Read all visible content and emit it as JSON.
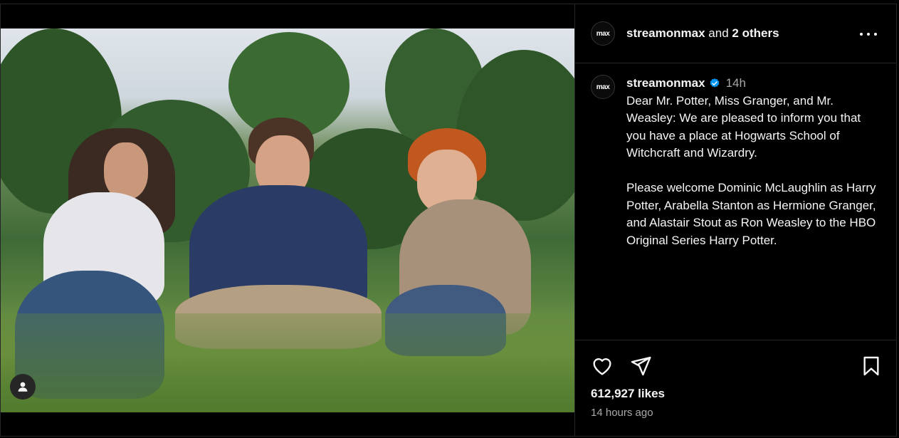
{
  "post": {
    "header_user": "streamonmax",
    "header_and": "and",
    "header_others": "2 others",
    "avatar_text": "max",
    "caption_user": "streamonmax",
    "caption_time": "14h",
    "caption_text": "Dear Mr. Potter, Miss Granger, and Mr. Weasley: We are pleased to inform you that you have a place at Hogwarts School of Witchcraft and Wizardry.\n\nPlease welcome Dominic McLaughlin as Harry Potter, Arabella Stanton as Hermione Granger, and Alastair Stout as Ron Weasley to the HBO Original Series Harry Potter.",
    "likes": "612,927 likes",
    "time_ago": "14 hours ago"
  },
  "icons": {
    "more": "more-options-icon",
    "verified": "verified-badge-icon",
    "like": "heart-icon",
    "share": "send-icon",
    "save": "bookmark-icon",
    "user_tag": "user-tag-icon"
  },
  "colors": {
    "background": "#000000",
    "border": "#262626",
    "text": "#f5f5f5",
    "muted": "#a8a8a8",
    "verified": "#0095f6"
  }
}
